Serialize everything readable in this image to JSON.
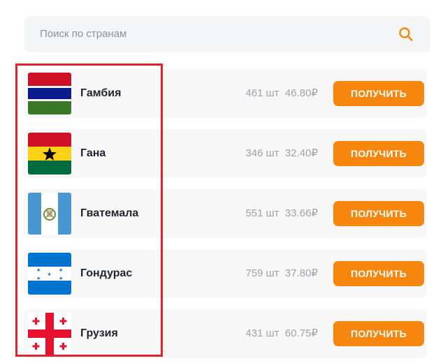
{
  "search": {
    "placeholder": "Поиск по странам",
    "icon": "search-icon"
  },
  "accent_color": "#f7860f",
  "highlight_color": "#e0242d",
  "countries": [
    {
      "name": "Гамбия",
      "qty": "461 шт",
      "price": "46.80₽",
      "button": "ПОЛУЧИТЬ"
    },
    {
      "name": "Гана",
      "qty": "346 шт",
      "price": "32.40₽",
      "button": "ПОЛУЧИТЬ"
    },
    {
      "name": "Гватемала",
      "qty": "551 шт",
      "price": "33.66₽",
      "button": "ПОЛУЧИТЬ"
    },
    {
      "name": "Гондурас",
      "qty": "759 шт",
      "price": "37.80₽",
      "button": "ПОЛУЧИТЬ"
    },
    {
      "name": "Грузия",
      "qty": "431 шт",
      "price": "60.75₽",
      "button": "ПОЛУЧИТЬ"
    }
  ]
}
